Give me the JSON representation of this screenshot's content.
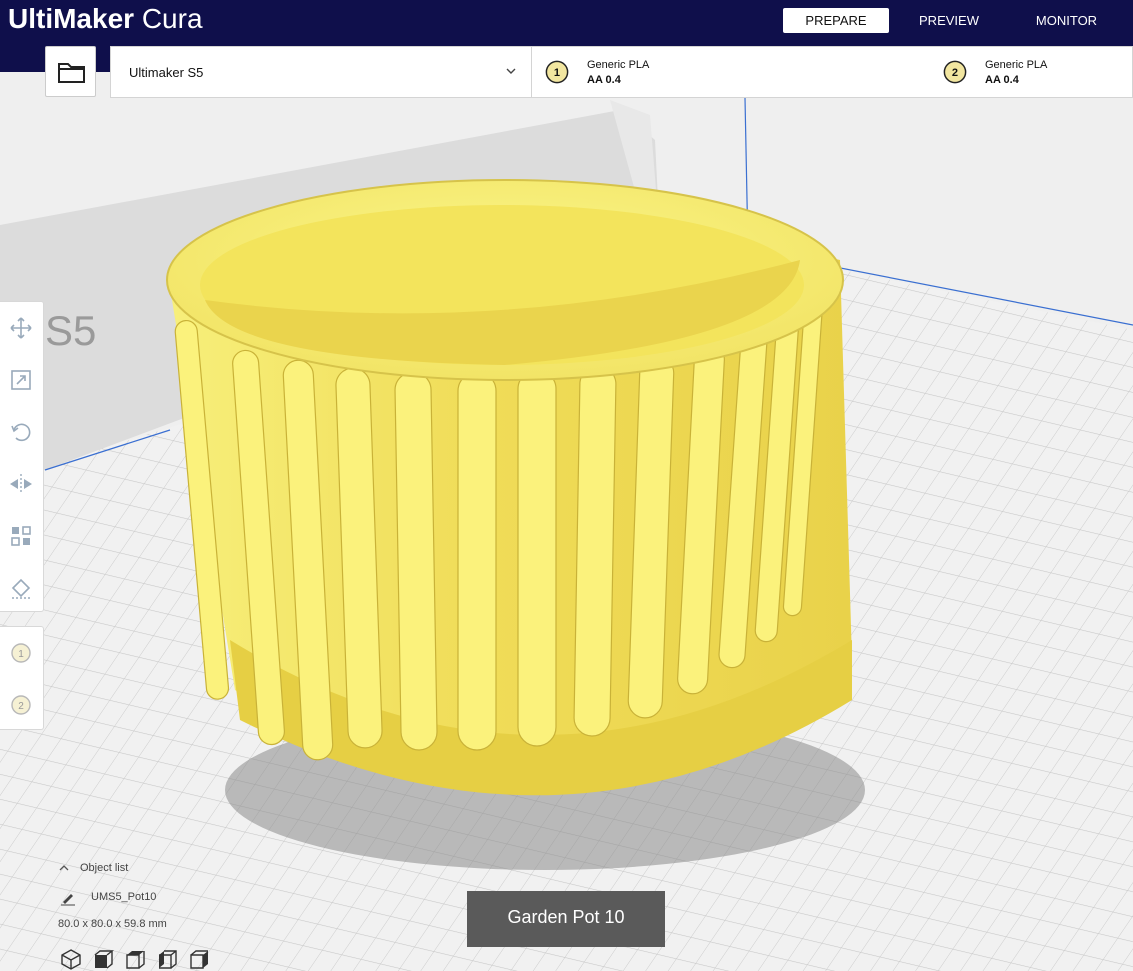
{
  "app": {
    "logo_bold": "UltiMaker",
    "logo_light": " Cura"
  },
  "stages": [
    {
      "label": "PREPARE",
      "active": true
    },
    {
      "label": "PREVIEW",
      "active": false
    },
    {
      "label": "MONITOR",
      "active": false
    }
  ],
  "printer": {
    "name": "Ultimaker S5"
  },
  "extruders": [
    {
      "number": "1",
      "material": "Generic PLA",
      "core": "AA 0.4"
    },
    {
      "number": "2",
      "material": "Generic PLA",
      "core": "AA 0.4"
    }
  ],
  "scene": {
    "build_plate_label": "S5",
    "model_color": "#f5e65a"
  },
  "tools": [
    "move-icon",
    "scale-icon",
    "rotate-icon",
    "mirror-icon",
    "per-model-settings-icon",
    "support-blocker-icon"
  ],
  "extruder_tools": [
    "1",
    "2"
  ],
  "object_list": {
    "header": "Object list",
    "object_name": "UMS5_Pot10",
    "dimensions": "80.0 x 80.0 x 59.8 mm"
  },
  "tooltip": "Garden Pot 10",
  "colors": {
    "topbar": "#0f0f4b",
    "accent": "#0f0f4b"
  }
}
